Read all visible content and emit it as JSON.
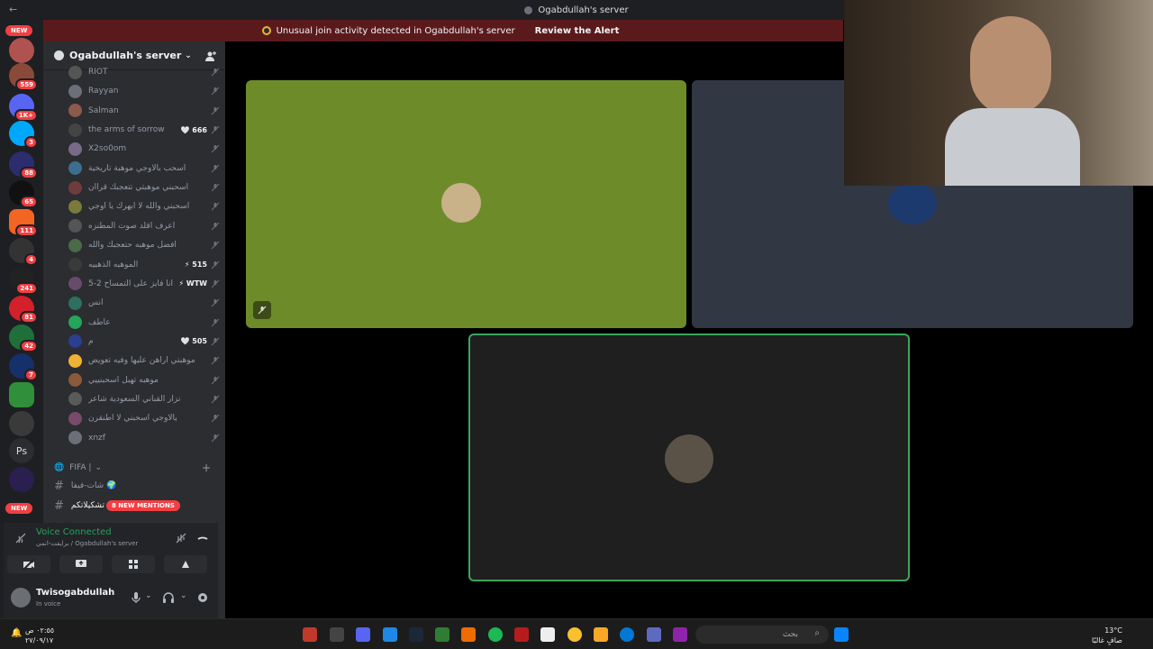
{
  "title_bar": {
    "title": "Ogabdullah's server"
  },
  "alert": {
    "text": "Unusual join activity detected in Ogabdullah's server",
    "action": "Review the Alert"
  },
  "rail": {
    "new_label": "NEW",
    "badges": [
      "559",
      "1K+",
      "3",
      "88",
      "65",
      "111",
      "4",
      "241",
      "81",
      "42",
      "7"
    ],
    "ps_label": "Ps",
    "new_label_bottom": "NEW"
  },
  "server": {
    "name": "Ogabdullah's server"
  },
  "members": [
    {
      "name": "RIOT",
      "tag": ""
    },
    {
      "name": "Rayyan",
      "tag": ""
    },
    {
      "name": "Salman",
      "tag": ""
    },
    {
      "name": "the arms of sorrow",
      "tag": "🤍 666"
    },
    {
      "name": "X2so0om",
      "tag": ""
    },
    {
      "name": "اسحب بالاوجي موهبة تاريخية",
      "tag": ""
    },
    {
      "name": "اسحبني موهبتي تتعجبك قراان",
      "tag": ""
    },
    {
      "name": "اسحبني والله لا ابهرك يا اوجي",
      "tag": ""
    },
    {
      "name": "اعرف اقلد صوت المطنزه",
      "tag": ""
    },
    {
      "name": "افضل موهبه حتعجبك والله",
      "tag": ""
    },
    {
      "name": "الموهبه الذهبيه",
      "tag": "⚡ 515"
    },
    {
      "name": "انا فايز على التمساح 2-5 😎",
      "tag": "⚡ WTW"
    },
    {
      "name": "انس",
      "tag": ""
    },
    {
      "name": "عاطف",
      "tag": ""
    },
    {
      "name": "م",
      "tag": "🤍 505"
    },
    {
      "name": "موهبتي اراهن عليها وفيه تعويض",
      "tag": ""
    },
    {
      "name": "موهبه تهبل اسحبنييي",
      "tag": ""
    },
    {
      "name": "نزار القباني السعودية شاعر",
      "tag": ""
    },
    {
      "name": "يالاوجي اسحبني لا اطنقرن",
      "tag": ""
    },
    {
      "name": "xnzf",
      "tag": ""
    }
  ],
  "category": {
    "label": "FIFA |"
  },
  "channels": [
    {
      "name": "شات-فيفا 🌍",
      "mentions": ""
    },
    {
      "name": "تشكيلاتكم",
      "mentions": "8 NEW MENTIONS"
    }
  ],
  "voice": {
    "status": "Voice Connected",
    "location": "برايفت-انمي / Ogabdullah's server"
  },
  "user": {
    "name": "Twisogabdullah",
    "status": "In voice"
  },
  "taskbar": {
    "time": "٠٢:٥٥ ص",
    "date": "٢٧/٠٩/١٧",
    "search_placeholder": "بحث",
    "temp": "13°C",
    "weather": "صافٍ غالبًا"
  },
  "colors": {
    "accent_green": "#23a55a",
    "alert_red": "#5a1a1c",
    "tile_green": "#6e8b2a",
    "tile_slate": "#313844",
    "tile_dark": "#1f1f1f",
    "speaking_border": "#3ba55c"
  }
}
